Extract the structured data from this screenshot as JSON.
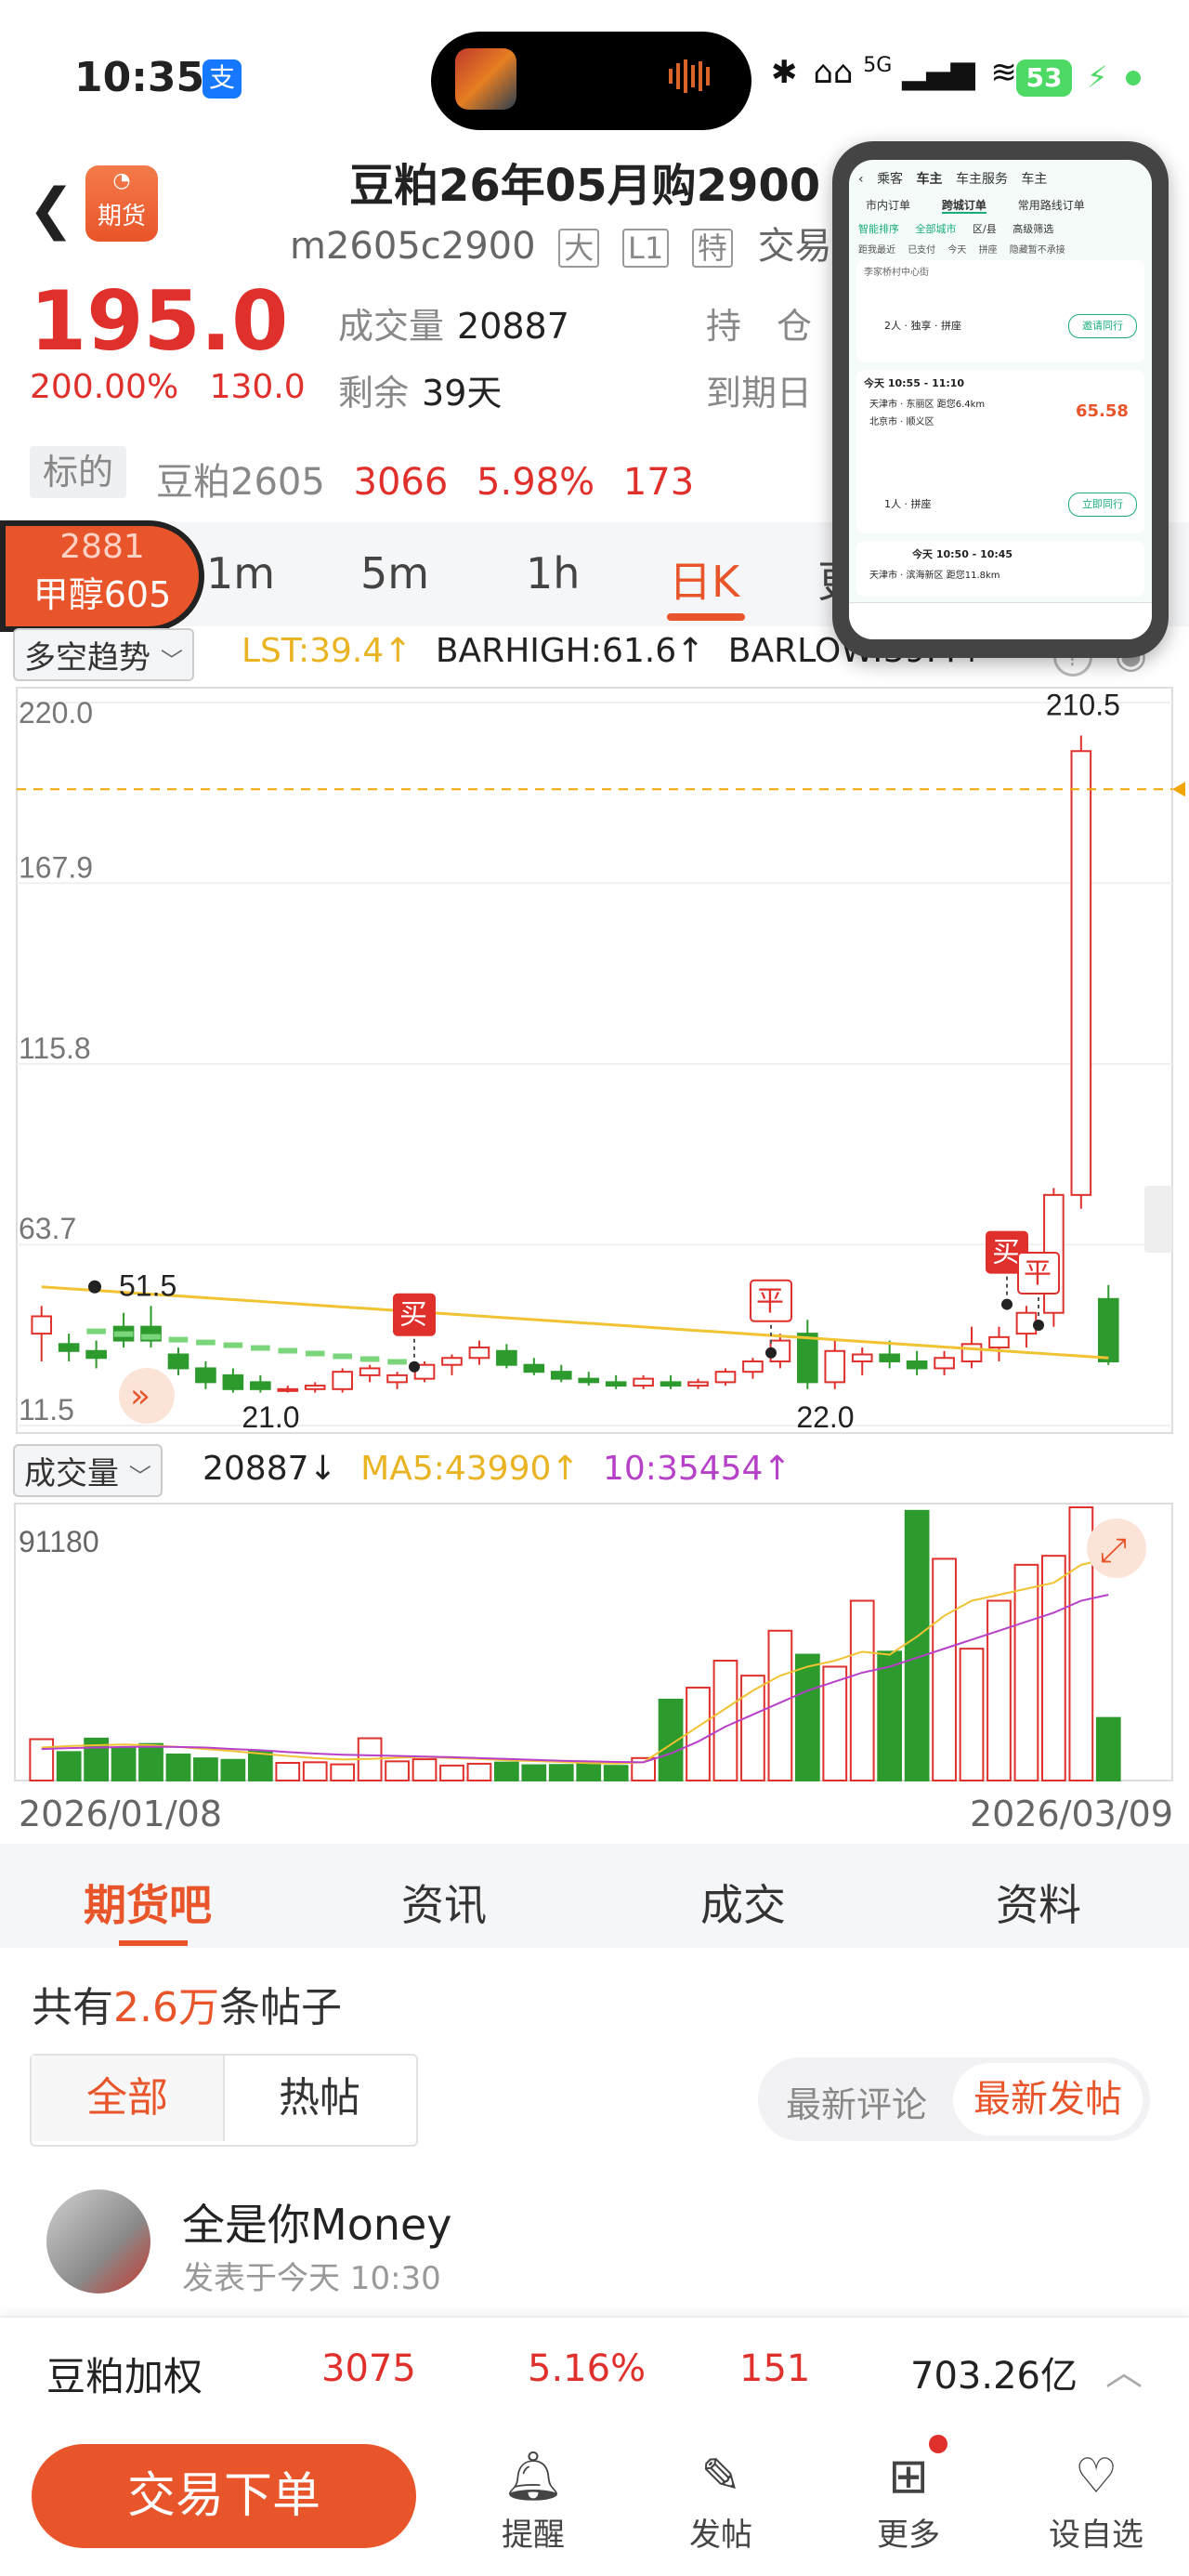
{
  "status_bar": {
    "time": "10:35",
    "alipay": "支",
    "signal": "5G",
    "battery": "53"
  },
  "header": {
    "logo_text": "期货",
    "title": "豆粕26年05月购2900",
    "code": "m2605c2900",
    "tags": [
      "大",
      "L1",
      "特"
    ],
    "trade_status": "交易中"
  },
  "quote": {
    "price": "195.0",
    "change_pct": "200.00%",
    "change": "130.0",
    "volume_label": "成交量",
    "volume": "20887",
    "remain_label": "剩余",
    "remain": "39天",
    "hold_label": "持　仓",
    "expire_label": "到期日"
  },
  "underlying": {
    "label": "标的",
    "name": "豆粕2605",
    "price": "3066",
    "pct": "5.98%",
    "change": "173"
  },
  "float_badge": {
    "price": "2881",
    "name": "甲醇605"
  },
  "period_tabs": [
    "1m",
    "5m",
    "1h",
    "日K",
    "更"
  ],
  "indicator": {
    "select": "多空趋势",
    "lst": "LST:39.4↑",
    "barhigh": "BARHIGH:61.6↑",
    "barlow": "BARLOW:39.4↑"
  },
  "volume_indicator": {
    "select": "成交量",
    "vol": "20887↓",
    "ma5": "MA5:43990↑",
    "ma10": "10:35454↑"
  },
  "dates": {
    "start": "2026/01/08",
    "end": "2026/03/09"
  },
  "chart_data": {
    "type": "candlestick",
    "y_ticks": [
      "220.0",
      "167.9",
      "115.8",
      "63.7",
      "11.5"
    ],
    "ylim": [
      11.5,
      220.0
    ],
    "annotations": {
      "max": "210.5",
      "min_left": "21.0",
      "min_right": "22.0",
      "left_mark": "51.5",
      "buy": "买",
      "close": "平"
    },
    "candles": [
      [
        38,
        46,
        30,
        43
      ],
      [
        35,
        38,
        30,
        33
      ],
      [
        33,
        36,
        28,
        31
      ],
      [
        40,
        44,
        34,
        36
      ],
      [
        40,
        46,
        34,
        36
      ],
      [
        32,
        34,
        26,
        28
      ],
      [
        28,
        30,
        22,
        24
      ],
      [
        26,
        28,
        21,
        22
      ],
      [
        24,
        26,
        21,
        22
      ],
      [
        22,
        23,
        21,
        22
      ],
      [
        22,
        24,
        21,
        23
      ],
      [
        22,
        28,
        21,
        27
      ],
      [
        26,
        29,
        24,
        28
      ],
      [
        24,
        27,
        22,
        26
      ],
      [
        25,
        30,
        24,
        29
      ],
      [
        29,
        32,
        26,
        31
      ],
      [
        31,
        36,
        29,
        34
      ],
      [
        33,
        35,
        28,
        29
      ],
      [
        29,
        31,
        26,
        27
      ],
      [
        27,
        29,
        24,
        25
      ],
      [
        25,
        27,
        23,
        24
      ],
      [
        24,
        26,
        22,
        23
      ],
      [
        23,
        26,
        22,
        25
      ],
      [
        24,
        26,
        22,
        23
      ],
      [
        23,
        25,
        22,
        24
      ],
      [
        24,
        28,
        23,
        27
      ],
      [
        27,
        31,
        25,
        30
      ],
      [
        30,
        38,
        28,
        36
      ],
      [
        38,
        42,
        22,
        24
      ],
      [
        24,
        36,
        22,
        33
      ],
      [
        30,
        34,
        26,
        32
      ],
      [
        32,
        36,
        28,
        30
      ],
      [
        30,
        33,
        26,
        28
      ],
      [
        28,
        33,
        26,
        31
      ],
      [
        30,
        40,
        28,
        35
      ],
      [
        34,
        40,
        30,
        37
      ],
      [
        38,
        46,
        34,
        44
      ],
      [
        44,
        80,
        40,
        78
      ],
      [
        78,
        210.5,
        74,
        206
      ],
      [
        48,
        52,
        29,
        30
      ]
    ],
    "volume_ticks": [
      "91180"
    ],
    "volumes": [
      13800,
      9500,
      14000,
      11000,
      12200,
      8700,
      7400,
      6900,
      9800,
      5900,
      6100,
      5400,
      14100,
      6400,
      7100,
      5000,
      5600,
      6000,
      5100,
      5200,
      6300,
      4900,
      7500,
      27000,
      31000,
      40000,
      35000,
      50000,
      42000,
      38000,
      60000,
      43000,
      90000,
      74000,
      44000,
      60000,
      72000,
      75000,
      91180,
      20887
    ],
    "ma5": [
      11000,
      11500,
      11800,
      12000,
      11800,
      11200,
      10500,
      9800,
      9000,
      8200,
      7500,
      7000,
      7200,
      7600,
      7900,
      7500,
      7200,
      6800,
      6500,
      6200,
      5800,
      5700,
      6100,
      12000,
      18000,
      24000,
      30000,
      35000,
      38000,
      40000,
      43000,
      42000,
      48000,
      55000,
      60000,
      62000,
      64000,
      66000,
      72000,
      74000
    ],
    "ma10": [
      10500,
      10800,
      11000,
      11200,
      11300,
      11200,
      11000,
      10500,
      10100,
      9500,
      9000,
      8600,
      8400,
      8200,
      8000,
      7800,
      7500,
      7200,
      6900,
      6600,
      6400,
      6200,
      6100,
      9000,
      13000,
      18000,
      22000,
      26000,
      30000,
      33000,
      36000,
      38000,
      41000,
      44000,
      47000,
      50000,
      53000,
      56000,
      60000,
      62000
    ],
    "lst_line": [
      51.5,
      31
    ],
    "colors": {
      "up": "#e0302c",
      "down": "#2c9a2c",
      "lst": "#f1c232",
      "ma10": "#b740c8"
    }
  },
  "section_tabs": [
    "期货吧",
    "资讯",
    "成交",
    "资料"
  ],
  "posts": {
    "prefix": "共有",
    "count": "2.6万",
    "suffix": "条帖子"
  },
  "filters": {
    "all": "全部",
    "hot": "热帖",
    "latest_comment": "最新评论",
    "latest_post": "最新发帖"
  },
  "post": {
    "user": "全是你Money",
    "time": "发表于今天 10:30"
  },
  "ticker": {
    "name": "豆粕加权",
    "price": "3075",
    "pct": "5.16%",
    "change": "151",
    "amount": "703.26亿"
  },
  "bottom_nav": {
    "trade": "交易下单",
    "remind": "提醒",
    "post": "发帖",
    "more": "更多",
    "watch": "设自选"
  },
  "pip": {
    "tabs": [
      "乘客",
      "车主",
      "车主服务",
      "车主"
    ],
    "subtabs": [
      "市内订单",
      "跨城订单",
      "常用路线订单"
    ],
    "filters": [
      "智能排序",
      "全部城市",
      "区/县",
      "高级筛选"
    ],
    "chips": [
      "距我最近",
      "已支付",
      "今天",
      "拼座",
      "隐藏暂不承接"
    ],
    "item1_route": "李家桥村中心街",
    "item1_people": "2人 · 独享 · 拼座",
    "item1_btn": "邀请同行",
    "item2_time": "今天 10:55 - 11:10",
    "item2_from": "天津市 · 东丽区 距您6.4km",
    "item2_to": "北京市 · 顺义区",
    "item2_price": "65.58",
    "item3_people": "1人 · 拼座",
    "item3_btn": "立即同行",
    "item4_time": "今天 10:50 - 10:45",
    "item4_from": "天津市 · 滨海新区 距您11.8km"
  }
}
